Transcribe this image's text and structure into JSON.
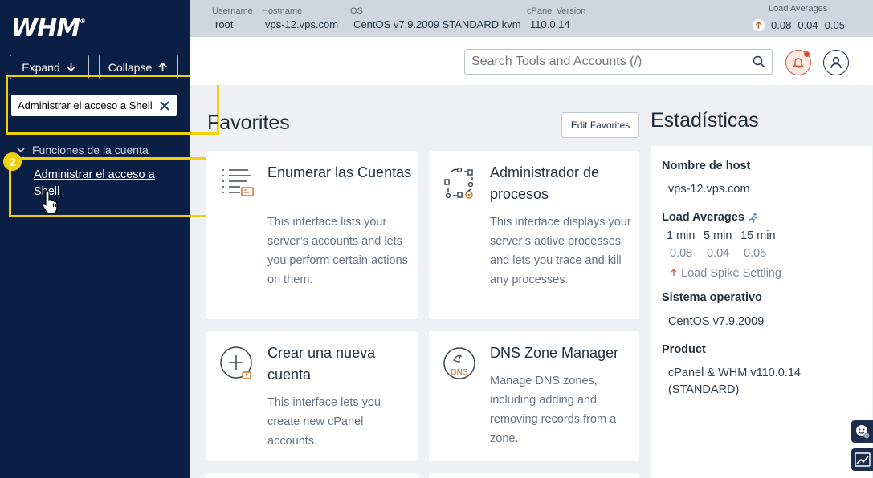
{
  "sidebar": {
    "logo": "WHM",
    "logo_mark": "®",
    "expand_label": "Expand",
    "collapse_label": "Collapse",
    "search_value": "Administrar el acceso a Shell",
    "group_label": "Funciones de la cuenta",
    "link_label": "Administrar el acceso a Shell",
    "step_badge": "2"
  },
  "topbar": {
    "username_label": "Username",
    "username": "root",
    "hostname_label": "Hostname",
    "hostname": "vps-12.vps.com",
    "os_label": "OS",
    "os": "CentOS v7.9.2009 STANDARD kvm",
    "cpanel_label": "cPanel Version",
    "cpanel": "110.0.14",
    "loads_label": "Load Averages",
    "loads": [
      "0.08",
      "0.04",
      "0.05"
    ]
  },
  "header": {
    "search_placeholder": "Search Tools and Accounts (/)"
  },
  "favorites": {
    "title": "Favorites",
    "edit_label": "Edit Favorites",
    "cards": [
      {
        "title": "Enumerar las Cuentas",
        "desc": "This interface lists your server’s accounts and lets you perform certain actions on them.",
        "icon": "list-accounts-icon"
      },
      {
        "title": "Administrador de procesos",
        "desc": "This interface displays your server’s active processes and lets you trace and kill any processes.",
        "icon": "process-manager-icon"
      },
      {
        "title": "Crear una nueva cuenta",
        "desc": "This interface lets you create new cPanel accounts.",
        "icon": "create-account-icon"
      },
      {
        "title": "DNS Zone Manager",
        "desc": "Manage DNS zones, including adding and removing records from a zone.",
        "icon": "dns-icon",
        "icon_text": "DNS"
      }
    ]
  },
  "stats": {
    "title": "Estadísticas",
    "hostname_h": "Nombre de host",
    "hostname_v": "vps-12.vps.com",
    "loads_h": "Load Averages",
    "loads_cols": [
      "1 min",
      "5 min",
      "15 min"
    ],
    "loads_vals": [
      "0.08",
      "0.04",
      "0.05"
    ],
    "spike": "Load Spike Settling",
    "os_h": "Sistema operativo",
    "os_v": "CentOS v7.9.2009",
    "product_h": "Product",
    "product_v1": "cPanel & WHM v110.0.14",
    "product_v2": "(STANDARD)"
  },
  "colors": {
    "sidebar_bg": "#0b1e44",
    "highlight": "#f2cf0b",
    "topbar_bg": "#cfd6df",
    "accent_orange": "#d0532b"
  }
}
